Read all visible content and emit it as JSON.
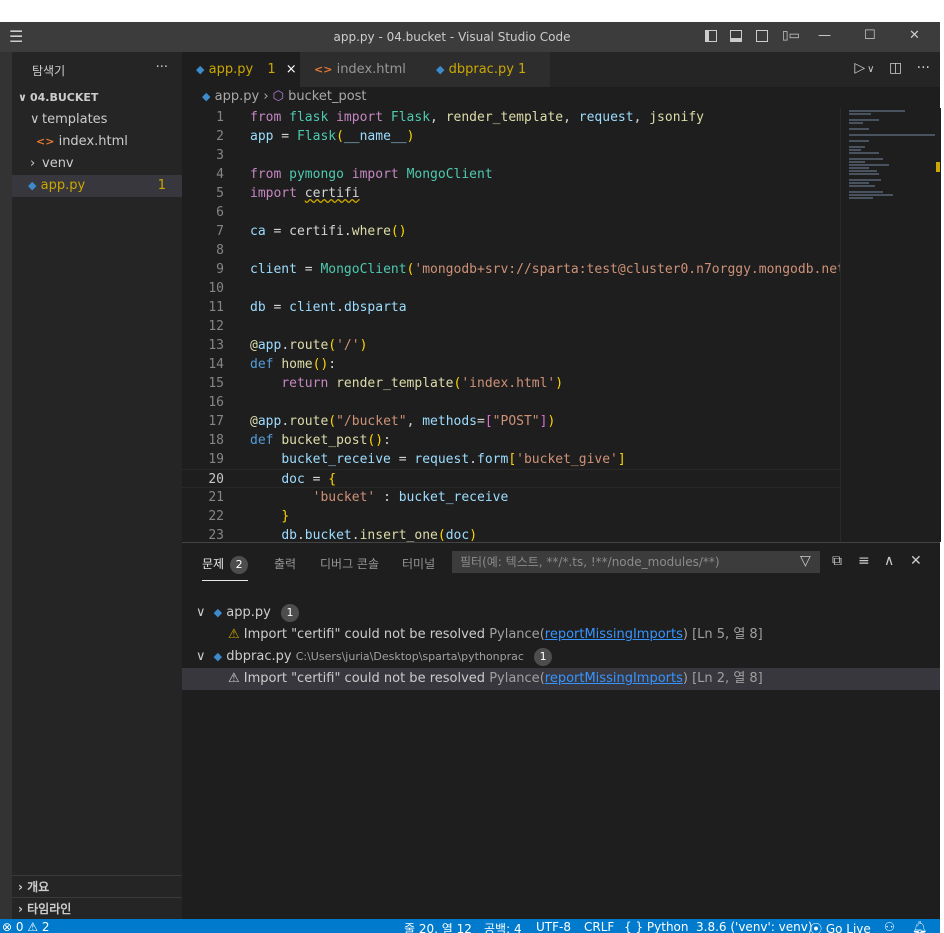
{
  "window": {
    "title": "app.py - 04.bucket - Visual Studio Code"
  },
  "sidebar": {
    "header": "탐색기",
    "more": "···",
    "folder": "04.BUCKET",
    "items": [
      {
        "label": "templates"
      },
      {
        "label": "index.html"
      },
      {
        "label": "venv"
      },
      {
        "label": "app.py",
        "badge": "1"
      }
    ],
    "bottom": [
      {
        "label": "개요"
      },
      {
        "label": "타임라인"
      }
    ]
  },
  "tabs": [
    {
      "label": "app.py",
      "badge": "1",
      "close": "×"
    },
    {
      "label": "index.html"
    },
    {
      "label": "dbprac.py",
      "badge": "1"
    }
  ],
  "breadcrumb": {
    "file": "app.py",
    "symbol": "bucket_post"
  },
  "editor": {
    "line_numbers": [
      "1",
      "2",
      "3",
      "4",
      "5",
      "6",
      "7",
      "8",
      "9",
      "10",
      "11",
      "12",
      "13",
      "14",
      "15",
      "16",
      "17",
      "18",
      "19",
      "20",
      "21",
      "22",
      "23"
    ],
    "current_line": "20"
  },
  "panel": {
    "tabs": [
      {
        "label": "문제",
        "badge": "2"
      },
      {
        "label": "출력"
      },
      {
        "label": "디버그 콘솔"
      },
      {
        "label": "터미널"
      }
    ],
    "filter_placeholder": "필터(예: 텍스트, **/*.ts, !**/node_modules/**)",
    "groups": [
      {
        "file": "app.py",
        "path": "",
        "count": "1",
        "problem": {
          "message": "Import \"certifi\" could not be resolved",
          "source": "Pylance",
          "code": "reportMissingImports",
          "position": "[Ln 5, 열 8]"
        }
      },
      {
        "file": "dbprac.py",
        "path": "C:\\Users\\juria\\Desktop\\sparta\\pythonprac",
        "count": "1",
        "problem": {
          "message": "Import \"certifi\" could not be resolved",
          "source": "Pylance",
          "code": "reportMissingImports",
          "position": "[Ln 2, 열 8]"
        }
      }
    ]
  },
  "statusbar": {
    "problems": "⊗ 0 ⚠ 2",
    "position": "줄 20, 열 12",
    "spaces": "공백: 4",
    "encoding": "UTF-8",
    "eol": "CRLF",
    "language": "{ } Python",
    "interpreter": "3.8.6 ('venv': venv)",
    "golive": "⦿ Go Live"
  },
  "colors": {
    "accent": "#007acc",
    "warning": "#cca700",
    "modified": "#cca700"
  },
  "icons": [
    "menu-icon",
    "layout-sidebar-icon",
    "layout-panel-icon",
    "layout-split-icon",
    "layout-custom-icon",
    "minimize-icon",
    "maximize-icon",
    "close-icon",
    "python-file-icon",
    "html-file-icon",
    "run-icon",
    "split-editor-icon",
    "more-icon",
    "filter-icon",
    "collapse-all-icon",
    "view-as-tree-icon",
    "maximize-panel-icon",
    "close-panel-icon",
    "warning-icon",
    "symbol-method-icon"
  ]
}
